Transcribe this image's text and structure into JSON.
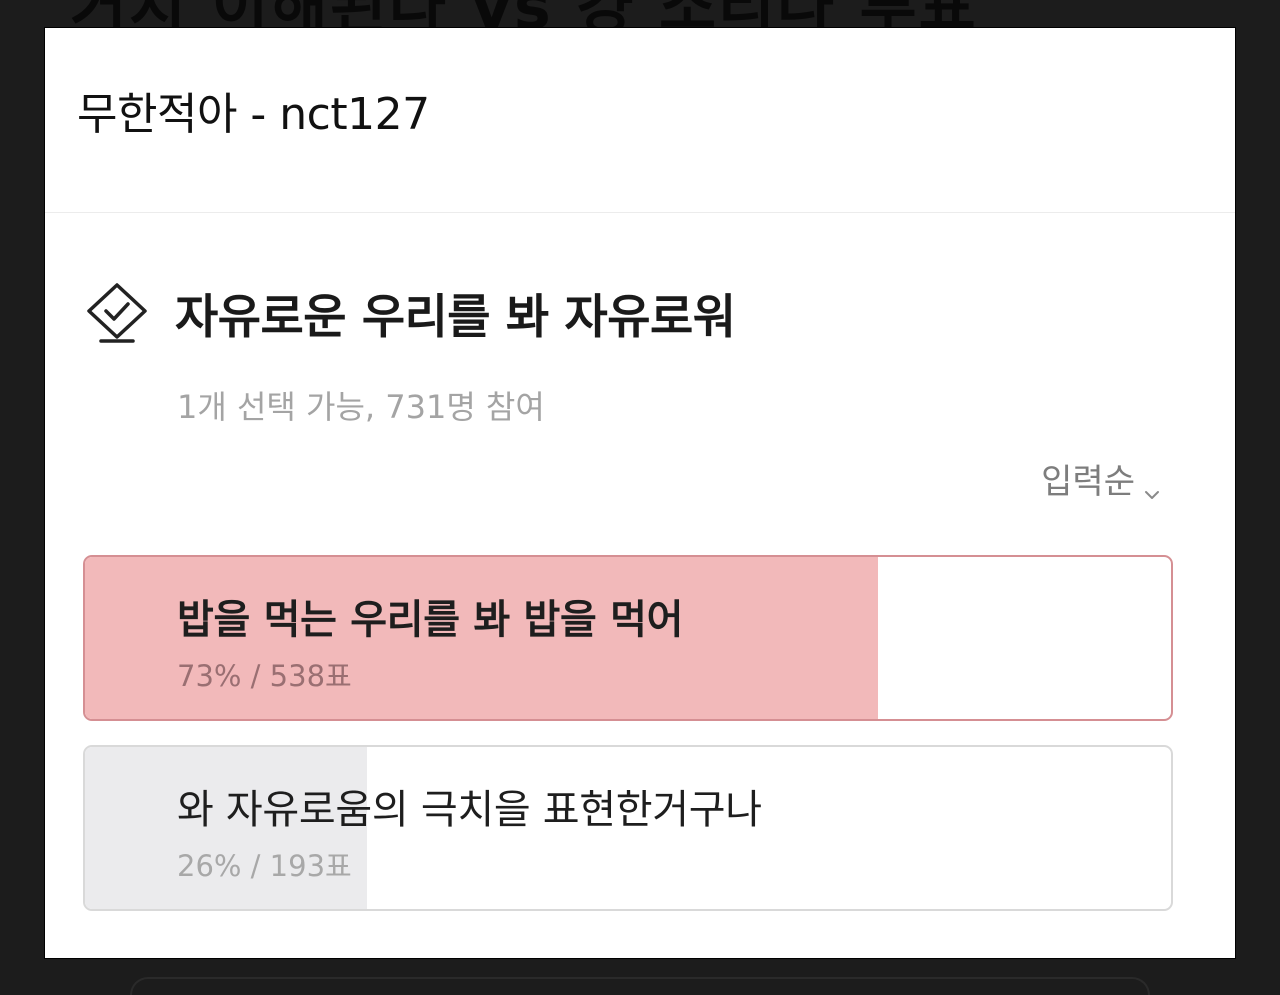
{
  "background_title": "거지 이해된다 vs 걍 소리나 투표",
  "chat": {
    "title": "무한적아 - nct127"
  },
  "poll": {
    "icon": "vote-box-icon",
    "title": "자유로운 우리를 봐 자유로워",
    "meta": "1개 선택 가능, 731명 참여",
    "sort_label": "입력순",
    "sort_icon": "chevron-down-icon",
    "options": [
      {
        "label": "밥을 먹는 우리를 봐 밥을 먹어",
        "stats": "73% / 538표",
        "percent": 73,
        "votes": 538,
        "color": "#f2b9ba"
      },
      {
        "label": "와 자유로움의 극치을 표현한거구나",
        "stats": "26% / 193표",
        "percent": 26,
        "votes": 193,
        "color": "#ebebed"
      }
    ]
  }
}
